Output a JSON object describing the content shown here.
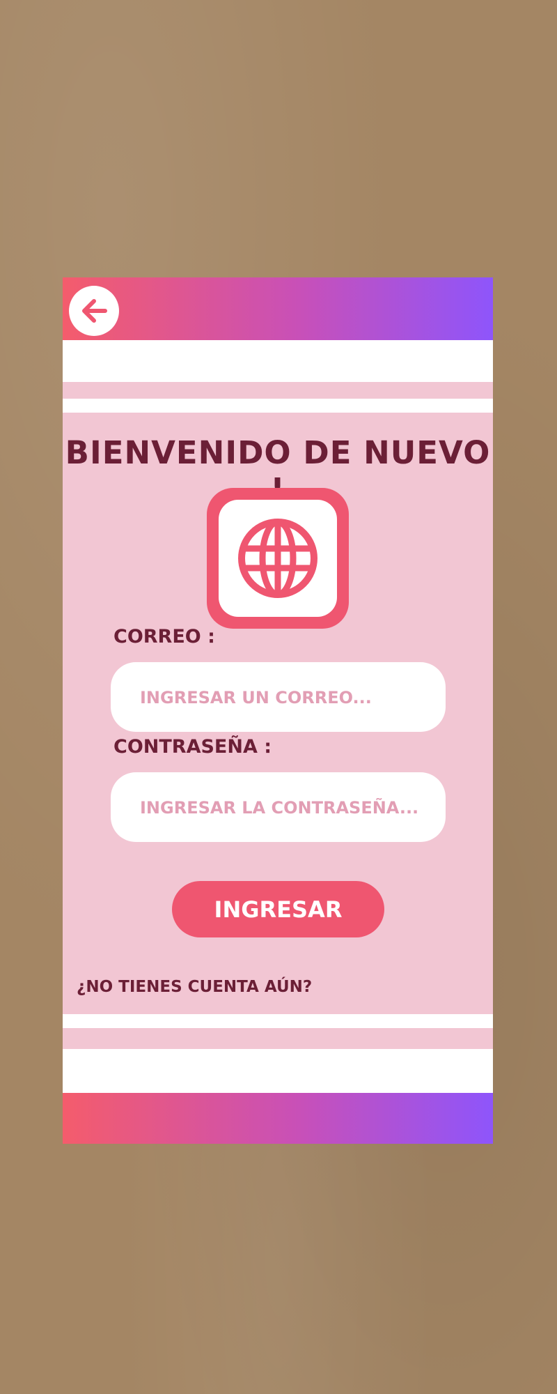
{
  "colors": {
    "background": "#a48664",
    "card": "#f2c6d3",
    "gradient_start": "#f45c6c",
    "gradient_mid": "#c850b8",
    "gradient_end": "#8e55fb",
    "accent": "#ef5670",
    "text": "#6b1f36",
    "placeholder": "#e29eb4"
  },
  "header": {
    "back_icon": "arrow-left-icon"
  },
  "login": {
    "title": "BIENVENIDO DE NUEVO !",
    "logo_icon": "globe-icon",
    "email": {
      "label": "CORREO :",
      "placeholder": "INGRESAR UN CORREO...",
      "value": ""
    },
    "password": {
      "label": "CONTRASEÑA :",
      "placeholder": "INGRESAR LA CONTRASEÑA...",
      "value": ""
    },
    "submit_label": "INGRESAR",
    "signup_text": "¿NO TIENES CUENTA AÚN?"
  }
}
